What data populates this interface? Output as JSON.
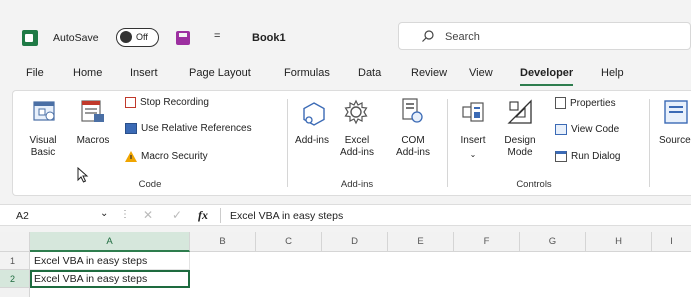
{
  "titlebar": {
    "autosave_label": "AutoSave",
    "autosave_state": "Off",
    "qat_more": "=",
    "workbook_name": "Book1",
    "search_placeholder": "Search"
  },
  "tabs": [
    "File",
    "Home",
    "Insert",
    "Page Layout",
    "Formulas",
    "Data",
    "Review",
    "View",
    "Developer",
    "Help"
  ],
  "active_tab": "Developer",
  "ribbon": {
    "code": {
      "visual_basic": "Visual Basic",
      "macros": "Macros",
      "stop_recording": "Stop Recording",
      "use_relative_references": "Use Relative References",
      "macro_security": "Macro Security",
      "group_label": "Code"
    },
    "addins": {
      "addins": "Add-ins",
      "excel_addins": "Excel Add-ins",
      "com_addins": "COM Add-ins",
      "group_label": "Add-ins"
    },
    "controls": {
      "insert": "Insert",
      "design_mode": "Design Mode",
      "properties": "Properties",
      "view_code": "View Code",
      "run_dialog": "Run Dialog",
      "group_label": "Controls"
    },
    "source": "Source"
  },
  "formula_bar": {
    "name_box": "A2",
    "fx": "fx",
    "content": "Excel VBA in easy steps"
  },
  "grid": {
    "columns": [
      "A",
      "B",
      "C",
      "D",
      "E",
      "F",
      "G",
      "H",
      "I"
    ],
    "rows": [
      {
        "num": "1",
        "a": "Excel VBA in easy steps"
      },
      {
        "num": "2",
        "a": "Excel VBA in easy steps"
      }
    ],
    "active_cell": "A2"
  },
  "colors": {
    "accent": "#2e7d4e",
    "excel_green": "#1f7a45",
    "save_purple": "#9c2fa0"
  }
}
